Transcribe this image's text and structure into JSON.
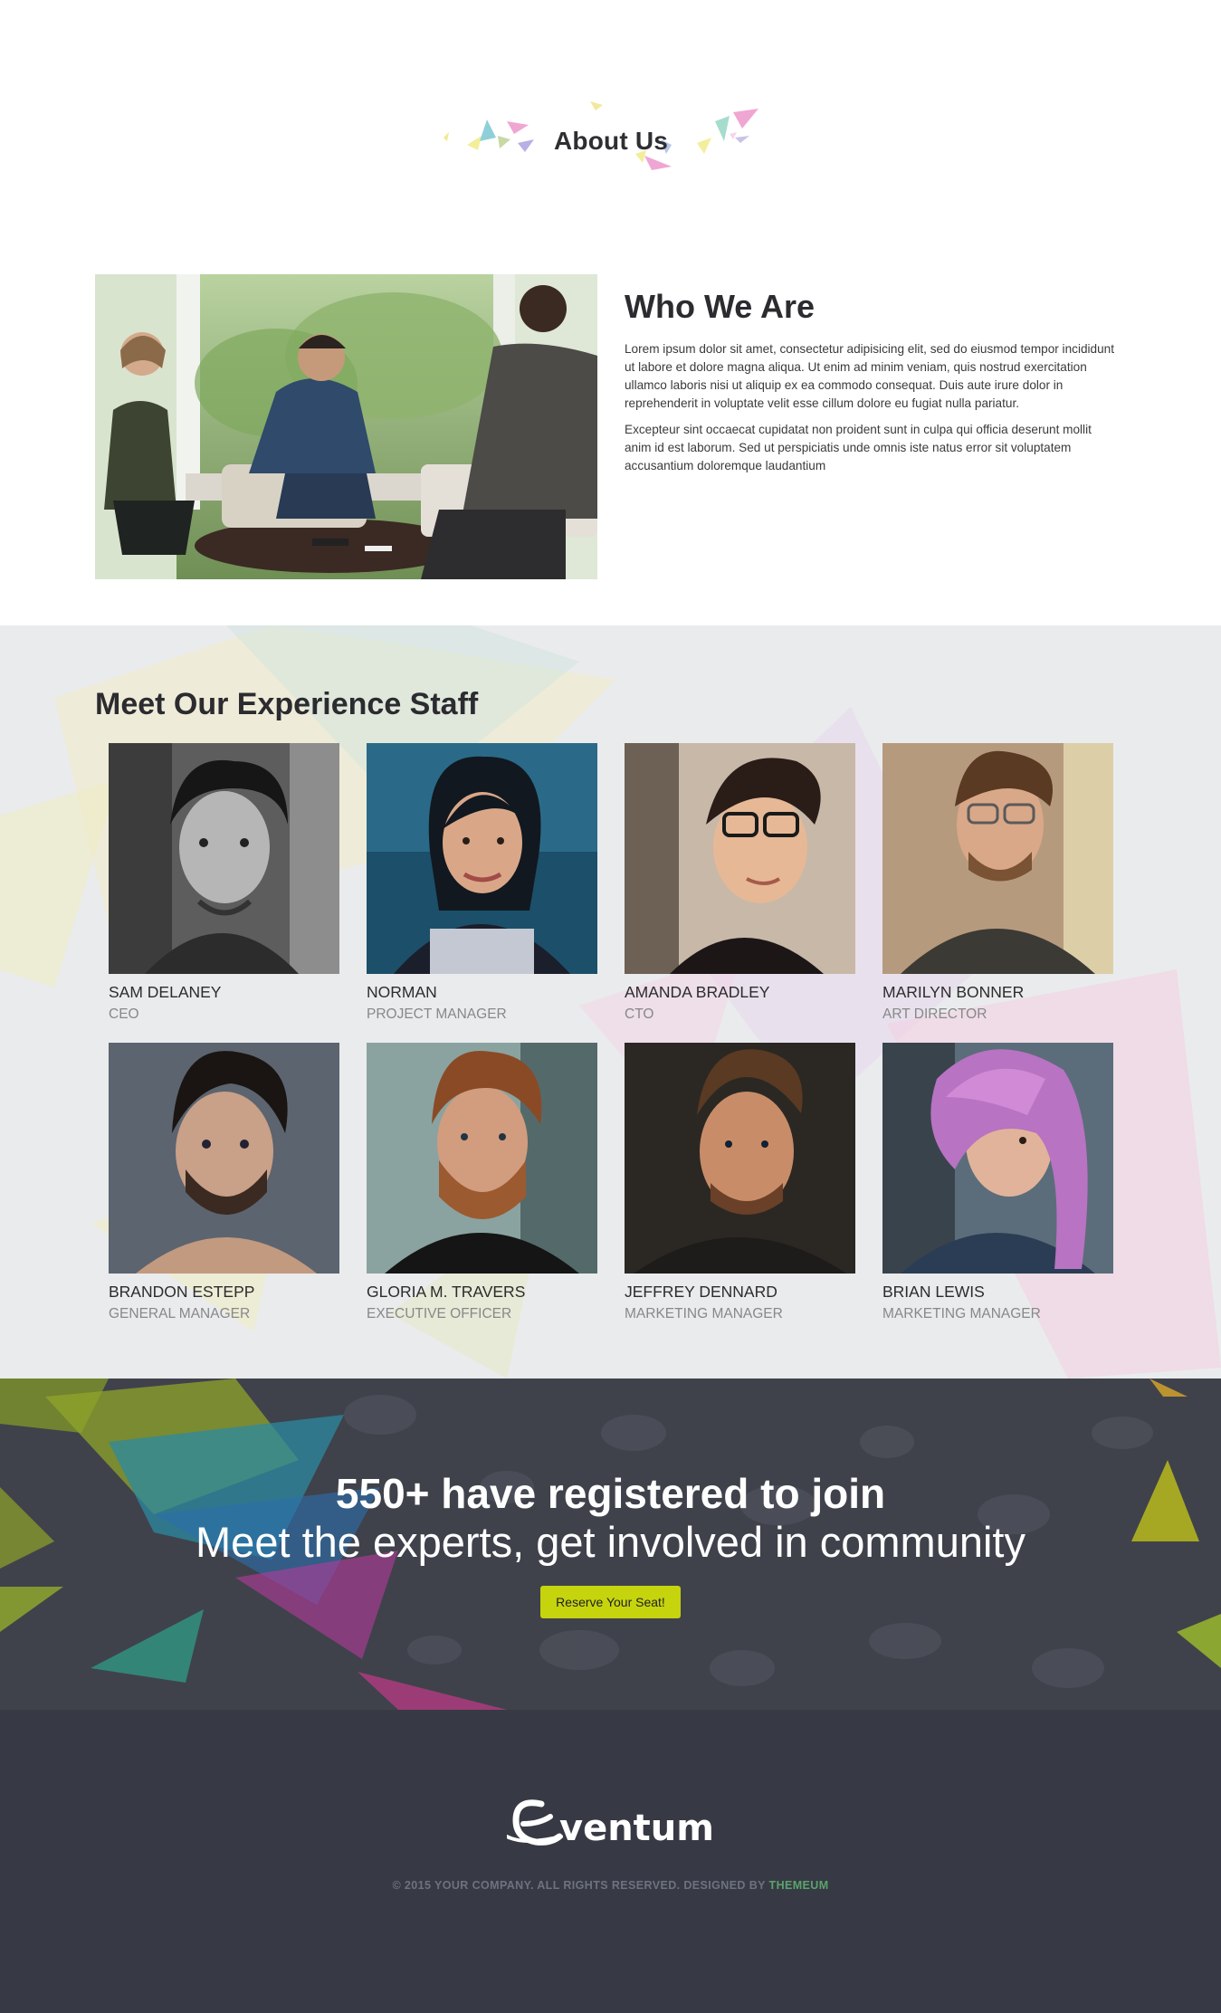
{
  "about": {
    "title": "About Us"
  },
  "who": {
    "heading": "Who We Are",
    "paragraphs": [
      "Lorem ipsum dolor sit amet, consectetur adipisicing elit, sed do eiusmod tempor incididunt ut labore et dolore magna aliqua. Ut enim ad minim veniam, quis nostrud exercitation ullamco laboris nisi ut aliquip ex ea commodo consequat. Duis aute irure dolor in reprehenderit in voluptate velit esse cillum dolore eu fugiat nulla pariatur.",
      "Excepteur sint occaecat cupidatat non proident sunt in culpa qui officia deserunt mollit anim id est laborum. Sed ut perspiciatis unde omnis iste natus error sit voluptatem accusantium doloremque laudantium"
    ]
  },
  "staff": {
    "heading": "Meet Our Experience Staff",
    "members": [
      {
        "name": "SAM DELANEY",
        "role": "CEO"
      },
      {
        "name": "NORMAN",
        "role": "PROJECT MANAGER"
      },
      {
        "name": "AMANDA BRADLEY",
        "role": "CTO"
      },
      {
        "name": "MARILYN BONNER",
        "role": "ART DIRECTOR"
      },
      {
        "name": "BRANDON ESTEPP",
        "role": "GENERAL MANAGER"
      },
      {
        "name": "GLORIA M. TRAVERS",
        "role": "EXECUTIVE OFFICER"
      },
      {
        "name": "JEFFREY DENNARD",
        "role": "MARKETING MANAGER"
      },
      {
        "name": "BRIAN LEWIS",
        "role": "MARKETING MANAGER"
      }
    ]
  },
  "cta": {
    "headline": "550+ have registered to join",
    "subline": "Meet the experts, get involved in community",
    "button_label": "Reserve Your Seat!",
    "button_color": "#c6d40d"
  },
  "footer": {
    "logo_text": "eventum",
    "copyright": "© 2015 YOUR COMPANY. ALL RIGHTS RESERVED. DESIGNED BY",
    "designer": "THEMEUM",
    "designer_color": "#5aa36c"
  },
  "colors": {
    "dark_bg": "#373a44",
    "staff_bg": "#eaebed",
    "heading": "#2b2b30"
  }
}
